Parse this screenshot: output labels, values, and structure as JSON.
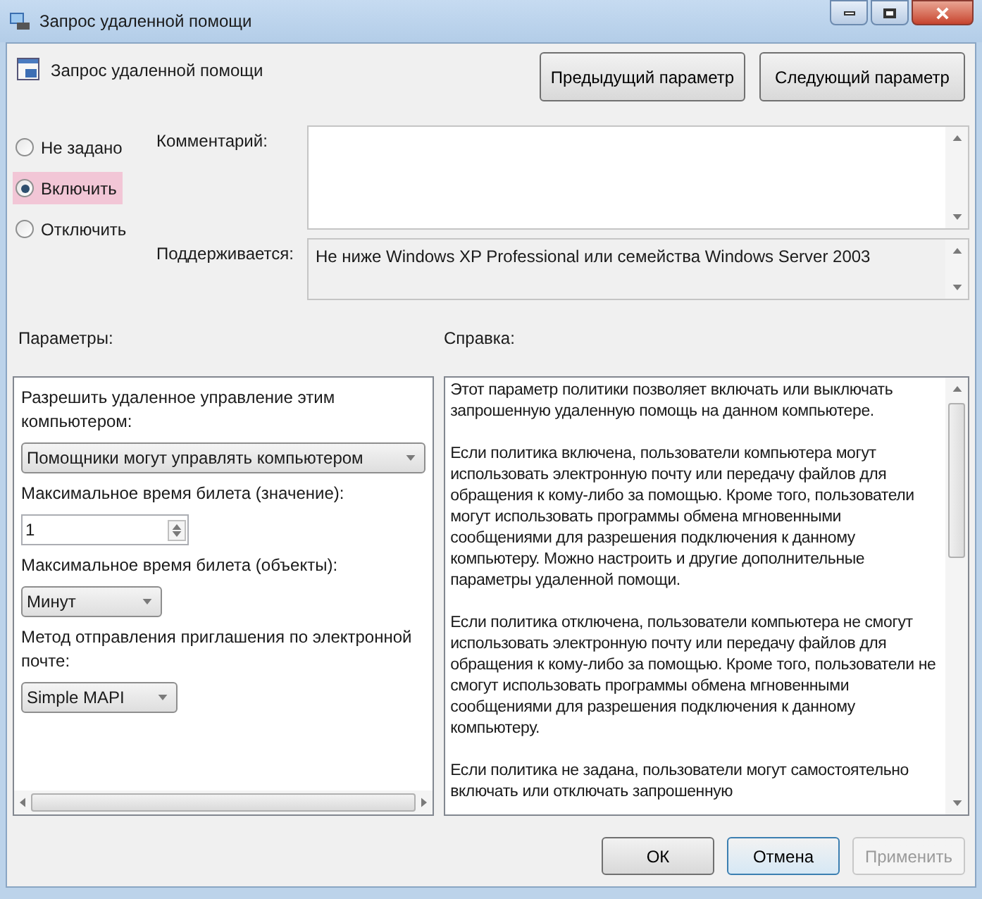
{
  "window": {
    "title": "Запрос удаленной помощи"
  },
  "header": {
    "title": "Запрос удаленной помощи"
  },
  "nav_buttons": [
    "Предыдущий параметр",
    "Следующий параметр"
  ],
  "state_options": [
    {
      "label": "Не задано",
      "selected": false
    },
    {
      "label": "Включить",
      "selected": true
    },
    {
      "label": "Отключить",
      "selected": false
    }
  ],
  "comment": {
    "label": "Комментарий:"
  },
  "supported": {
    "label": "Поддерживается:",
    "value": "Не ниже Windows XP Professional или семейства Windows Server 2003"
  },
  "options": {
    "label": "Параметры:",
    "items": [
      {
        "kind": "label",
        "text": "Разрешить удаленное управление этим компьютером:"
      },
      {
        "kind": "dropdown",
        "text": "Помощники могут управлять компьютером"
      },
      {
        "kind": "label",
        "text": "Максимальное время билета (значение):"
      },
      {
        "kind": "spinner",
        "text": "1"
      },
      {
        "kind": "label",
        "text": "Максимальное время билета (объекты):"
      },
      {
        "kind": "dropdown",
        "text": "Минут"
      },
      {
        "kind": "label",
        "text": "Метод отправления приглашения по электронной почте:"
      },
      {
        "kind": "dropdown",
        "text": "Simple MAPI"
      }
    ]
  },
  "help": {
    "label": "Справка:",
    "paragraphs": [
      "Этот параметр политики позволяет включать или выключать запрошенную удаленную помощь на данном компьютере.",
      "Если политика включена, пользователи компьютера могут использовать электронную почту или передачу файлов для обращения к кому-либо за помощью. Кроме того, пользователи могут использовать программы обмена мгновенными сообщениями для разрешения подключения к данному компьютеру. Можно настроить и другие дополнительные параметры удаленной помощи.",
      "Если политика отключена, пользователи компьютера не смогут использовать электронную почту или передачу файлов для обращения к кому-либо за помощью. Кроме того, пользователи не смогут использовать программы обмена мгновенными сообщениями для разрешения подключения к данному компьютеру.",
      "Если политика не задана, пользователи могут самостоятельно включать или отключать запрошенную"
    ]
  },
  "buttons": [
    {
      "label": "ОК",
      "disabled": false
    },
    {
      "label": "Отмена",
      "disabled": false
    },
    {
      "label": "Применить",
      "disabled": true
    }
  ]
}
